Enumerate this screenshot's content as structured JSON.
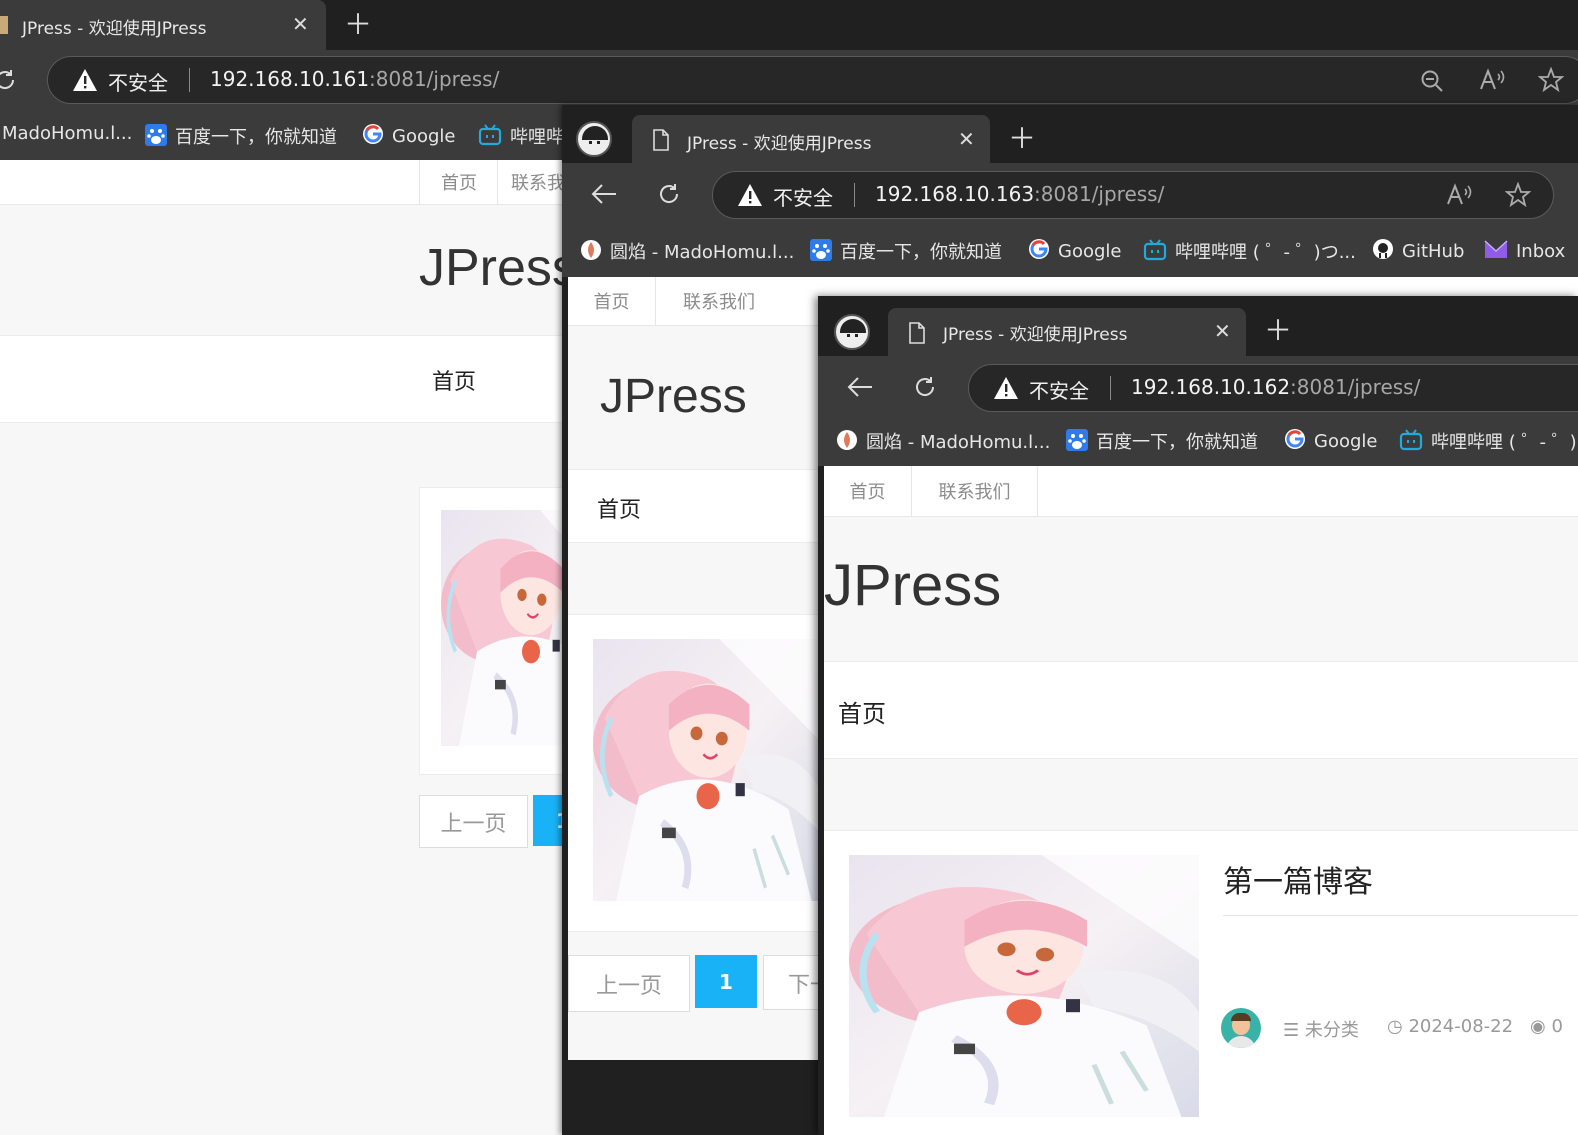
{
  "windows": [
    {
      "tab_title": "JPress - 欢迎使用JPress",
      "insecure_label": "不安全",
      "url_host": "192.168.10.161",
      "url_rest": ":8081/jpress/",
      "bookmarks": [
        "MadoHomu.l...",
        "百度一下，你就知道",
        "Google",
        "哔哩哔"
      ],
      "topnav": [
        "首页",
        "联系我"
      ],
      "brand": "JPress",
      "nav_home": "首页",
      "pager_prev": "上一页",
      "pager_current": "1"
    },
    {
      "tab_title": "JPress - 欢迎使用JPress",
      "insecure_label": "不安全",
      "url_host": "192.168.10.163",
      "url_rest": ":8081/jpress/",
      "bookmarks": [
        "圆焰 - MadoHomu.l...",
        "百度一下，你就知道",
        "Google",
        "哔哩哔哩 ( ゜- ゜)つ...",
        "GitHub",
        "Inbox"
      ],
      "topnav": [
        "首页",
        "联系我们"
      ],
      "brand": "JPress",
      "nav_home": "首页",
      "pager_prev": "上一页",
      "pager_current": "1",
      "pager_next": "下一"
    },
    {
      "tab_title": "JPress - 欢迎使用JPress",
      "insecure_label": "不安全",
      "url_host": "192.168.10.162",
      "url_rest": ":8081/jpress/",
      "bookmarks": [
        "圆焰 - MadoHomu.l...",
        "百度一下，你就知道",
        "Google",
        "哔哩哔哩 ( ゜- ゜)"
      ],
      "topnav": [
        "首页",
        "联系我们"
      ],
      "brand": "JPress",
      "nav_home": "首页",
      "post_title": "第一篇博客",
      "post_category": "未分类",
      "post_date": "2024-08-22",
      "post_views": "0"
    }
  ],
  "colors": {
    "accent": "#1ab2f6",
    "tabstrip": "#202020",
    "toolbar": "#3b3b3b"
  },
  "icons": [
    "warning-icon",
    "back-icon",
    "reload-icon",
    "zoom-out-icon",
    "read-aloud-icon",
    "favorite-star-icon",
    "new-tab-icon",
    "close-tab-icon",
    "page-icon",
    "avatar-icon",
    "category-icon",
    "clock-icon",
    "eye-icon"
  ]
}
